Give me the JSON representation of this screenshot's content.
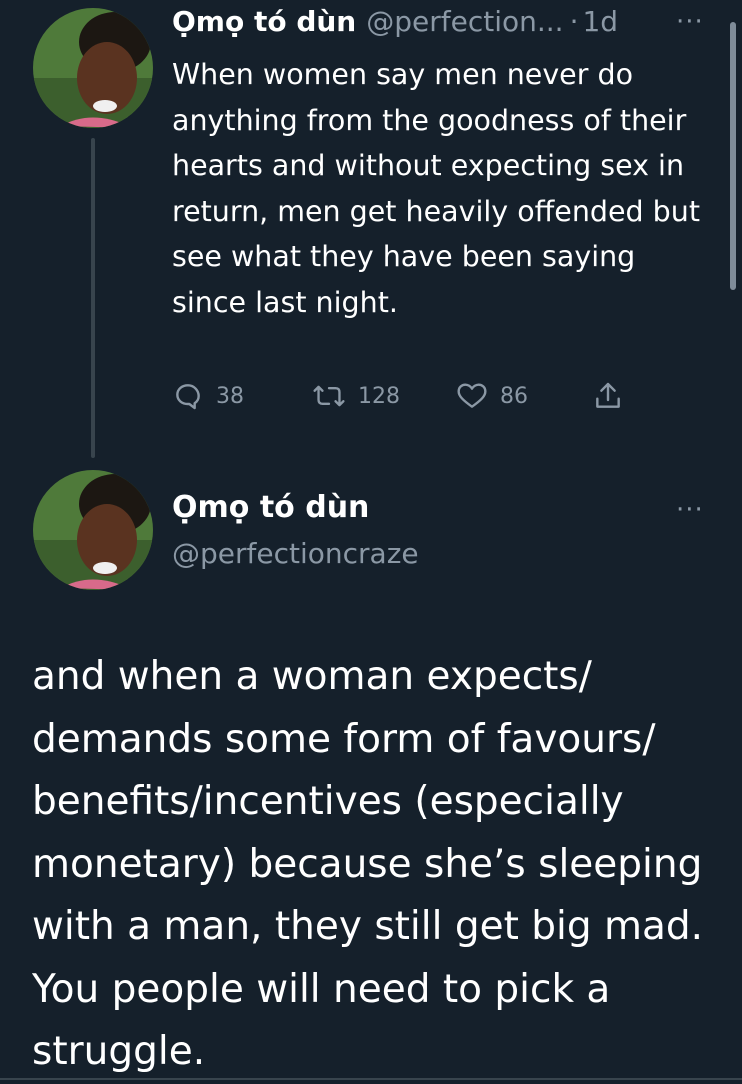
{
  "tweet1": {
    "display_name": "Ọmọ tó dùn",
    "handle": "@perfection...",
    "separator": "·",
    "time": "1d",
    "more": "···",
    "text": "When women say men never do anything from the goodness of their hearts and without expecting sex in return, men get heavily offended but see what they have been saying since last night.",
    "actions": {
      "replies": "38",
      "retweets": "128",
      "likes": "86"
    },
    "icons": [
      "reply-icon",
      "retweet-icon",
      "like-icon",
      "share-icon"
    ]
  },
  "tweet2": {
    "display_name": "Ọmọ tó dùn",
    "handle": "@perfectioncraze",
    "more": "···",
    "text": "and when a woman expects/ demands some form of favours/ benefits/incentives (especially monetary) because she’s sleeping with a man, they still get big mad. You people will need to pick a struggle."
  },
  "colors": {
    "background": "#15202b",
    "text": "#ffffff",
    "secondary_text": "#8b98a5",
    "divider": "#38444d"
  }
}
